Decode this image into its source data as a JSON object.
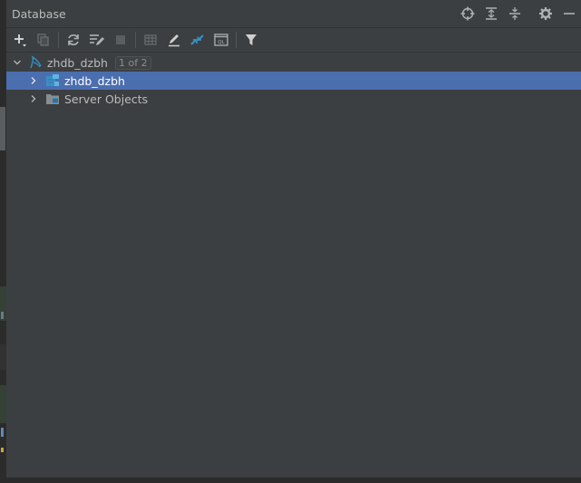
{
  "panel": {
    "title": "Database",
    "header_actions": [
      "target-icon",
      "expand-all-icon",
      "collapse-all-icon",
      "gear-icon",
      "minimize-icon"
    ]
  },
  "toolbar": {
    "buttons": [
      "add-icon",
      "duplicate-icon",
      "refresh-icon",
      "edit-properties-icon",
      "stop-icon",
      "table-view-icon",
      "edit-source-icon",
      "jump-to-icon",
      "query-console-icon",
      "filter-icon"
    ]
  },
  "tree": {
    "root": {
      "label": "zhdb_dzbh",
      "badge": "1 of 2",
      "expanded": true
    },
    "children": [
      {
        "label": "zhdb_dzbh",
        "selected": true,
        "expanded": false
      },
      {
        "label": "Server Objects",
        "selected": false,
        "expanded": false
      }
    ]
  },
  "colors": {
    "panel_bg": "#3c3f41",
    "selection": "#4b6eaf",
    "accent_blue": "#3592c4",
    "text": "#bbbbbb"
  }
}
